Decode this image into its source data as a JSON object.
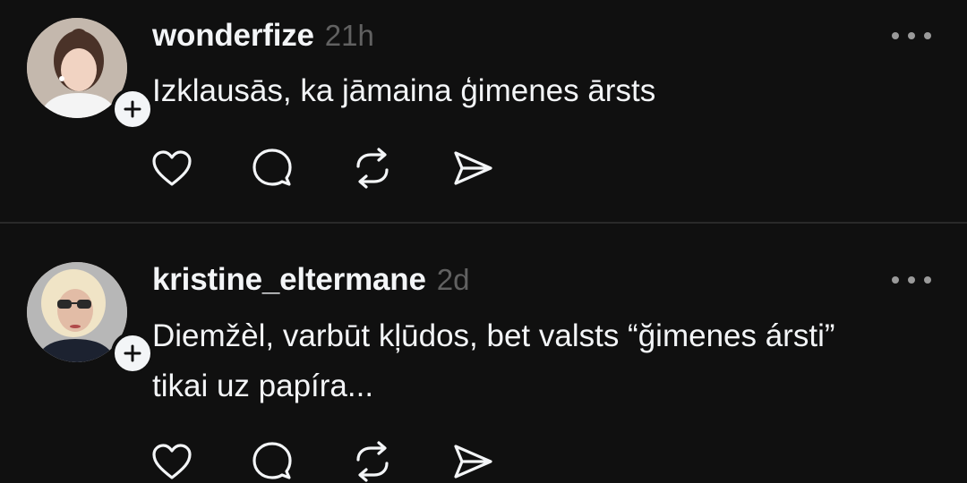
{
  "posts": [
    {
      "username": "wonderfize",
      "time": "21h",
      "text": "Izklausās, ka jāmaina ģimenes ārsts",
      "avatar_icon": "profile-photo-woman-dark-hair",
      "follow_icon": "plus-icon"
    },
    {
      "username": "kristine_eltermane",
      "time": "2d",
      "text_lines": [
        "Diemžèl, varbūt kļūdos, bet valsts “ğimenes ársti”",
        "tikai uz papíra..."
      ],
      "avatar_icon": "profile-photo-woman-blonde-sunglasses",
      "follow_icon": "plus-icon"
    }
  ],
  "actions": [
    "heart-icon",
    "comment-icon",
    "repost-icon",
    "share-icon"
  ],
  "colors": {
    "background": "#101010",
    "text": "#f3f5f7",
    "muted": "#616161",
    "divider": "#2a2a2a"
  }
}
